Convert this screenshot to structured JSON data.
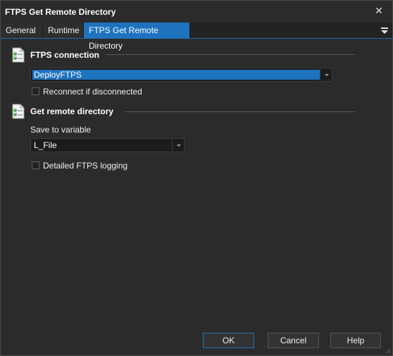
{
  "window": {
    "title": "FTPS Get Remote Directory"
  },
  "tabs": [
    {
      "label": "General"
    },
    {
      "label": "Runtime"
    },
    {
      "label": "FTPS Get Remote Directory",
      "active": true
    }
  ],
  "sections": {
    "connection": {
      "title": "FTPS connection",
      "dropdown_value": "DeployFTPS",
      "reconnect_label": "Reconnect if disconnected",
      "reconnect_checked": false
    },
    "remote_dir": {
      "title": "Get remote directory",
      "save_label": "Save to variable",
      "variable_value": "L_File",
      "logging_label": "Detailed FTPS logging",
      "logging_checked": false
    }
  },
  "buttons": {
    "ok": "OK",
    "cancel": "Cancel",
    "help": "Help"
  },
  "icons": {
    "close": "close-icon",
    "tab_menu": "menu-dropdown-icon",
    "section": "checklist-document-icon"
  },
  "colors": {
    "background": "#2b2b2b",
    "accent": "#1e73be",
    "text": "#f0f0f0"
  }
}
